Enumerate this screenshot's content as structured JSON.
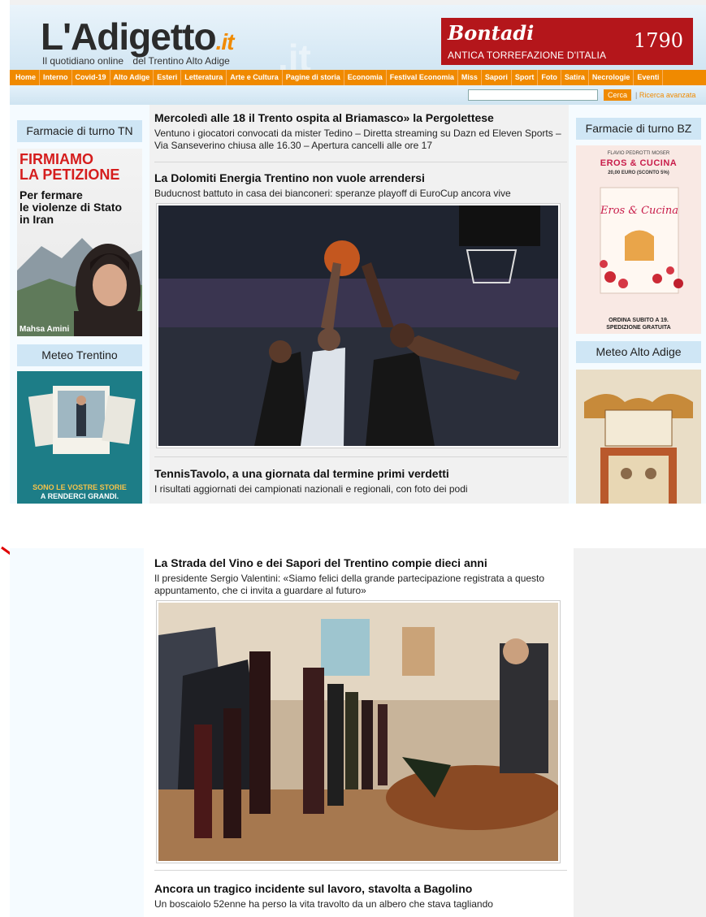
{
  "header": {
    "logo_text": "L'Adigetto",
    "logo_suffix": ".it",
    "tagline_left": "Il quotidiano online",
    "tagline_right": "del Trentino Alto Adige",
    "sponsor": {
      "brand": "Bontadi",
      "subtitle": "ANTICA TORREFAZIONE D'ITALIA",
      "year": "1790"
    }
  },
  "nav": {
    "items": [
      "Home",
      "Interno",
      "Covid-19",
      "Alto Adige",
      "Esteri",
      "Letteratura",
      "Arte e Cultura",
      "Pagine di storia",
      "Economia",
      "Festival Economia",
      "Miss",
      "Sapori",
      "Sport",
      "Foto",
      "Satira",
      "Necrologie",
      "Eventi"
    ]
  },
  "search": {
    "value": "",
    "button": "Cerca",
    "separator": "|",
    "advanced_link": "Ricerca avanzata"
  },
  "left_sidebar": {
    "pharmacy_title": "Farmacie di turno TN",
    "petition_ad": {
      "headline_red_1": "FIRMIAMO",
      "headline_red_2": "LA PETIZIONE",
      "line1": "Per fermare",
      "line2": "le violenze di Stato",
      "line3": "in Iran",
      "caption": "Mahsa Amini"
    },
    "weather_title": "Meteo Trentino",
    "stories_ad": {
      "line1": "SONO LE VOSTRE STORIE",
      "line2": "A RENDERCI GRANDI."
    }
  },
  "right_sidebar": {
    "pharmacy_title": "Farmacie di turno BZ",
    "book_ad": {
      "author": "FLAVIO PEDROTTI MOSER",
      "title": "EROS & CUCINA",
      "price": "20,00 EURO (SCONTO 5%)",
      "cover_title": "Eros & Cucina",
      "order_line1": "ORDINA SUBITO A 19.",
      "order_line2": "SPEDIZIONE GRATUITA"
    },
    "weather_title": "Meteo Alto Adige"
  },
  "articles": [
    {
      "headline": "Mercoledì alle 18 il Trento ospita al Briamasco» la Pergolettese",
      "summary": "Ventuno i giocatori convocati da mister Tedino – Diretta streaming su Dazn ed Eleven Sports – Via Sanseverino chiusa alle 16.30 – Apertura cancelli alle ore 17"
    },
    {
      "headline": "La Dolomiti Energia Trentino non vuole arrendersi",
      "summary": "Buducnost battuto in casa dei bianconeri: speranze playoff di EuroCup ancora vive"
    },
    {
      "headline": "TennisTavolo, a una giornata dal termine primi verdetti",
      "summary": "I risultati aggiornati dei campionati nazionali e regionali, con foto dei podi"
    },
    {
      "headline": "La Strada del Vino e dei Sapori del Trentino compie dieci anni",
      "summary": "Il presidente Sergio Valentini: «Siamo felici della grande partecipazione registrata a questo appuntamento, che ci invita a guardare al futuro»"
    },
    {
      "headline": "Ancora un tragico incidente sul lavoro, stavolta a Bagolino",
      "summary": "Un boscaiolo 52enne ha perso la vita travolto da un albero che stava tagliando"
    }
  ],
  "colors": {
    "brand_orange": "#f08a00",
    "sponsor_red": "#b4161b",
    "annotation_red": "#e00000"
  }
}
